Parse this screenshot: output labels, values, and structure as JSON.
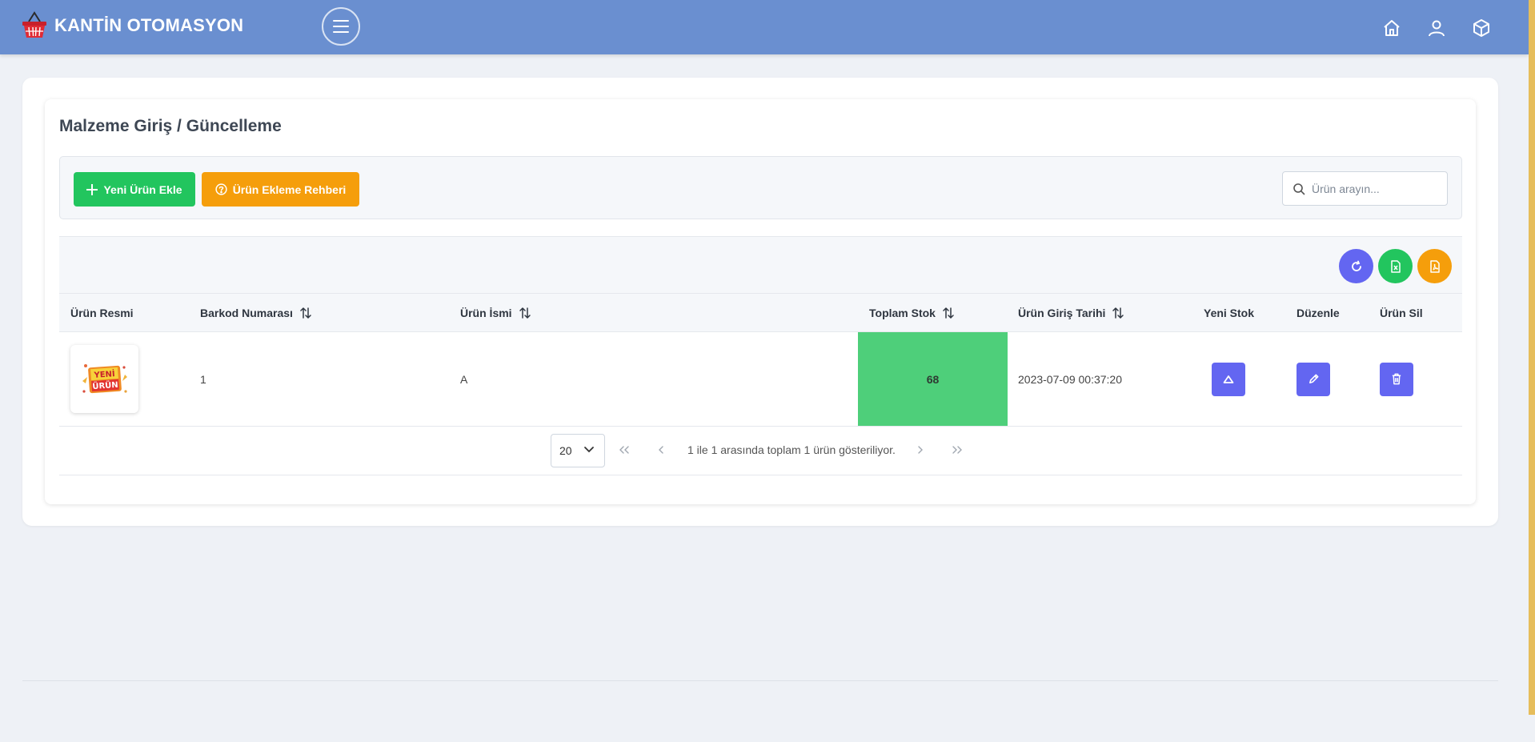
{
  "app": {
    "title": "KANTİN OTOMASYON"
  },
  "topbar": {
    "icons": [
      "home-icon",
      "user-icon",
      "box-icon"
    ]
  },
  "page": {
    "title": "Malzeme Giriş / Güncelleme"
  },
  "toolbar": {
    "add_label": "Yeni Ürün Ekle",
    "guide_label": "Ürün Ekleme Rehberi",
    "search_placeholder": "Ürün arayın..."
  },
  "table": {
    "columns": [
      "Ürün Resmi",
      "Barkod Numarası",
      "Ürün İsmi",
      "Toplam Stok",
      "Ürün Giriş Tarihi",
      "Yeni Stok",
      "Düzenle",
      "Ürün Sil"
    ],
    "rows": [
      {
        "image_label": "YENİ ÜRÜN",
        "barcode": "1",
        "name": "A",
        "total_stock": "68",
        "entry_date": "2023-07-09 00:37:20"
      }
    ]
  },
  "pager": {
    "page_size": "20",
    "info": "1 ile 1 arasında toplam 1 ürün gösteriliyor."
  },
  "colors": {
    "topbar": "#6a8fd0",
    "green": "#22c55e",
    "orange": "#f59e0b",
    "indigo": "#6366f1",
    "stock_cell": "#4ecf7a"
  }
}
